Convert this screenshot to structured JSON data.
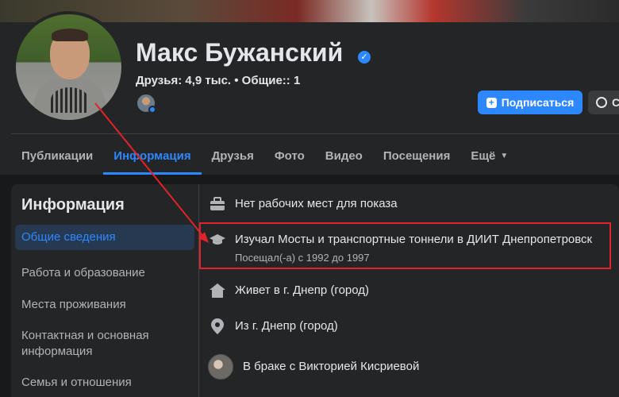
{
  "profile": {
    "name": "Макс Бужанский",
    "friends_line": "Друзья: 4,9 тыс. • Общие:: 1"
  },
  "actions": {
    "subscribe_label": "Подписаться",
    "message_label": "Со"
  },
  "tabs": [
    {
      "label": "Публикации"
    },
    {
      "label": "Информация"
    },
    {
      "label": "Друзья"
    },
    {
      "label": "Фото"
    },
    {
      "label": "Видео"
    },
    {
      "label": "Посещения"
    },
    {
      "label": "Ещё"
    }
  ],
  "sidebar": {
    "title": "Информация",
    "items": [
      {
        "label": "Общие сведения"
      },
      {
        "label": "Работа и образование"
      },
      {
        "label": "Места проживания"
      },
      {
        "label": "Контактная и основная информация"
      },
      {
        "label": "Семья и отношения"
      }
    ]
  },
  "overview": {
    "work": "Нет рабочих мест для показа",
    "education": "Изучал Мосты и транспортные тоннели в ДИИТ Днепропетровск",
    "education_years": "Посещал(-а) с 1992 до 1997",
    "lives": "Живет в г. Днепр (город)",
    "from": "Из г. Днепр (город)",
    "relationship": "В браке с Викторией Кисриевой"
  },
  "colors": {
    "accent": "#2d88ff",
    "annotation": "#e0222a",
    "background": "#18191a",
    "surface": "#242526"
  },
  "icons": {
    "verified": "verified-badge-icon",
    "work": "briefcase-icon",
    "education": "graduation-cap-icon",
    "lives": "home-icon",
    "from": "location-pin-icon"
  }
}
